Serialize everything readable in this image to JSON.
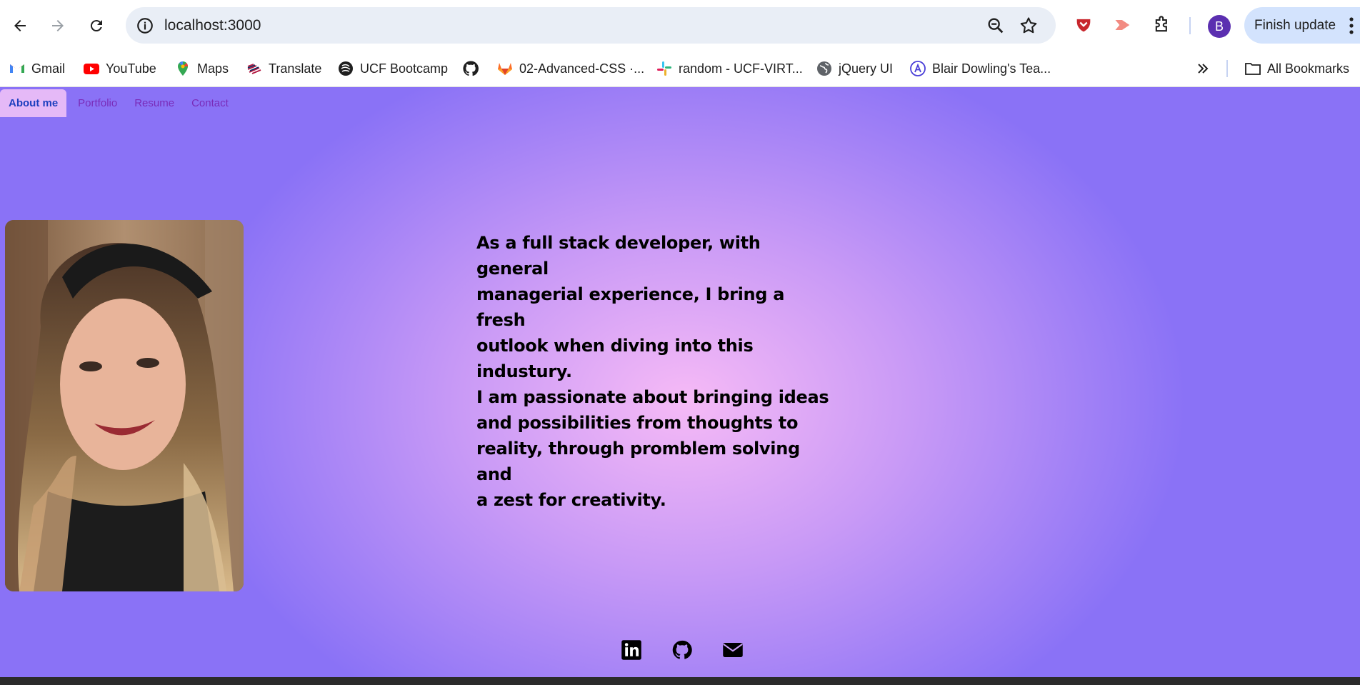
{
  "browser": {
    "url": "localhost:3000",
    "avatar_letter": "B",
    "update_label": "Finish update",
    "bookmarks": [
      {
        "label": "Gmail",
        "icon": "gmail-icon"
      },
      {
        "label": "YouTube",
        "icon": "youtube-icon"
      },
      {
        "label": "Maps",
        "icon": "maps-icon"
      },
      {
        "label": "Translate",
        "icon": "translate-icon"
      },
      {
        "label": "UCF Bootcamp",
        "icon": "ucf-icon"
      },
      {
        "label": "",
        "icon": "github-icon"
      },
      {
        "label": "02-Advanced-CSS ·...",
        "icon": "gitlab-icon"
      },
      {
        "label": "random - UCF-VIRT...",
        "icon": "slack-icon"
      },
      {
        "label": "jQuery UI",
        "icon": "globe-icon"
      },
      {
        "label": "Blair Dowling's Tea...",
        "icon": "angular-icon"
      }
    ],
    "all_bookmarks_label": "All Bookmarks"
  },
  "site": {
    "nav": [
      {
        "label": "About me",
        "active": true
      },
      {
        "label": "Portfolio",
        "active": false
      },
      {
        "label": "Resume",
        "active": false
      },
      {
        "label": "Contact",
        "active": false
      }
    ],
    "bio_lines": [
      "As a full stack developer, with general",
      "managerial experience, I bring a fresh",
      "outlook when diving into this industury.",
      "I am passionate about bringing ideas",
      "and possibilities from thoughts to",
      "reality, through promblem solving and",
      "a zest for creativity."
    ],
    "social_icons": [
      "linkedin-icon",
      "github-icon",
      "envelope-icon"
    ]
  },
  "colors": {
    "page_center": "#f6baf6",
    "page_edge": "#8a72f6",
    "nav_active_bg": "#e5b9f7",
    "nav_active_text": "#1c3fbf",
    "nav_text": "#7a2bb8",
    "update_pill": "#d3e3fd",
    "omnibox": "#e9eef6"
  }
}
